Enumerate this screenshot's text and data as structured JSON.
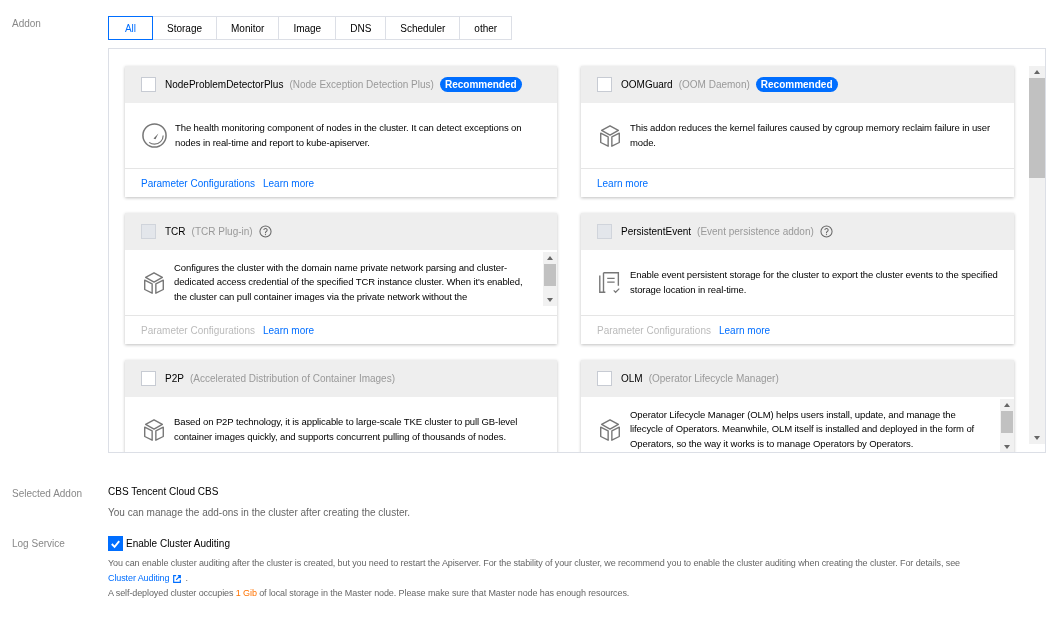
{
  "addon": {
    "label": "Addon",
    "tabs": [
      {
        "label": "All",
        "selected": true
      },
      {
        "label": "Storage",
        "selected": false
      },
      {
        "label": "Monitor",
        "selected": false
      },
      {
        "label": "Image",
        "selected": false
      },
      {
        "label": "DNS",
        "selected": false
      },
      {
        "label": "Scheduler",
        "selected": false
      },
      {
        "label": "other",
        "selected": false
      }
    ],
    "cards": [
      {
        "name": "NodeProblemDetectorPlus",
        "subtitle": "(Node Exception Detection Plus)",
        "badge": "Recommended",
        "help": false,
        "checked": false,
        "disabled": false,
        "kind": "gauge",
        "scrollable": false,
        "description": "The health monitoring component of nodes in the cluster. It can detect exceptions on nodes in real-time and report to kube-apiserver.",
        "links": [
          {
            "label": "Parameter Configurations",
            "disabled": false
          },
          {
            "label": "Learn more",
            "disabled": false
          }
        ]
      },
      {
        "name": "OOMGuard",
        "subtitle": "(OOM Daemon)",
        "badge": "Recommended",
        "help": false,
        "checked": false,
        "disabled": false,
        "kind": "cube",
        "scrollable": false,
        "description": "This addon reduces the kernel failures caused by cgroup memory reclaim failure in user mode.",
        "links": [
          {
            "label": "Learn more",
            "disabled": false
          }
        ]
      },
      {
        "name": "TCR",
        "subtitle": "(TCR Plug-in)",
        "help": true,
        "checked": false,
        "disabled": true,
        "kind": "cube",
        "scrollable": true,
        "description": "Configures the cluster with the domain name private network parsing and cluster-dedicated access credential of the specified TCR instance cluster. When it's enabled, the cluster can pull container images via the private network without the",
        "links": [
          {
            "label": "Parameter Configurations",
            "disabled": true
          },
          {
            "label": "Learn more",
            "disabled": false
          }
        ]
      },
      {
        "name": "PersistentEvent",
        "subtitle": "(Event persistence addon)",
        "help": true,
        "checked": false,
        "disabled": true,
        "kind": "document",
        "scrollable": false,
        "description": "Enable event persistent storage for the cluster to export the cluster events to the specified storage location in real-time.",
        "links": [
          {
            "label": "Parameter Configurations",
            "disabled": true
          },
          {
            "label": "Learn more",
            "disabled": false
          }
        ]
      },
      {
        "name": "P2P",
        "subtitle": "(Accelerated Distribution of Container Images)",
        "help": false,
        "checked": false,
        "disabled": false,
        "kind": "cube",
        "scrollable": false,
        "description": "Based on P2P technology, it is applicable to large-scale TKE cluster to pull GB-level container images quickly, and supports concurrent pulling of thousands of nodes."
      },
      {
        "name": "OLM",
        "subtitle": "(Operator Lifecycle Manager)",
        "help": false,
        "checked": false,
        "disabled": false,
        "kind": "cube",
        "scrollable": true,
        "description": "Operator Lifecycle Manager (OLM) helps users install, update, and manage the lifecycle of Operators. Meanwhile, OLM itself is installed and deployed in the form of Operators, so the way it works is to manage Operators by Operators."
      }
    ]
  },
  "selected_addon": {
    "label": "Selected Addon",
    "value": "CBS Tencent Cloud CBS",
    "note": "You can manage the add-ons in the cluster after creating the cluster."
  },
  "log_service": {
    "label": "Log Service",
    "checkbox": {
      "label": "Enable Cluster Auditing",
      "checked": true
    },
    "description": "You can enable cluster auditing after the cluster is created, but you need to restart the Apiserver. For the stability of your cluster, we recommend you to enable the cluster auditing when creating the cluster. For details, see",
    "link": "Cluster Auditing",
    "link_after": ".",
    "storage_note": {
      "before": "A self-deployed cluster occupies",
      "highlight": "1 Gib",
      "after": "of local storage in the Master node. Please make sure that Master node has enough resources."
    }
  }
}
